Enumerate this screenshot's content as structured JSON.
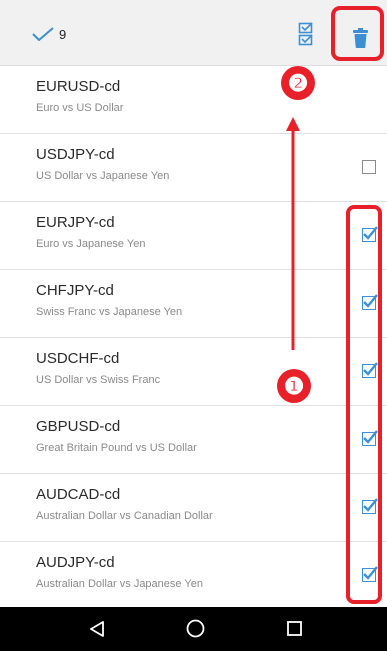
{
  "toolbar": {
    "selected_count": "9",
    "done_icon": "check-icon",
    "select_all_icon": "select-all-icon",
    "delete_icon": "trash-icon"
  },
  "symbols": [
    {
      "symbol": "EURUSD-cd",
      "desc": "Euro vs US Dollar",
      "checked": true
    },
    {
      "symbol": "USDJPY-cd",
      "desc": "US Dollar vs Japanese Yen",
      "checked": false
    },
    {
      "symbol": "EURJPY-cd",
      "desc": "Euro vs Japanese Yen",
      "checked": true
    },
    {
      "symbol": "CHFJPY-cd",
      "desc": "Swiss Franc vs Japanese Yen",
      "checked": true
    },
    {
      "symbol": "USDCHF-cd",
      "desc": "US Dollar vs Swiss Franc",
      "checked": true
    },
    {
      "symbol": "GBPUSD-cd",
      "desc": "Great Britain Pound vs US Dollar",
      "checked": true
    },
    {
      "symbol": "AUDCAD-cd",
      "desc": "Australian Dollar vs Canadian Dollar",
      "checked": true
    },
    {
      "symbol": "AUDJPY-cd",
      "desc": "Australian Dollar vs Japanese Yen",
      "checked": true
    }
  ],
  "annotations": {
    "step1": "❶",
    "step2": "❷"
  },
  "colors": {
    "accent": "#3d8fd3",
    "annotation": "#e8202a"
  }
}
